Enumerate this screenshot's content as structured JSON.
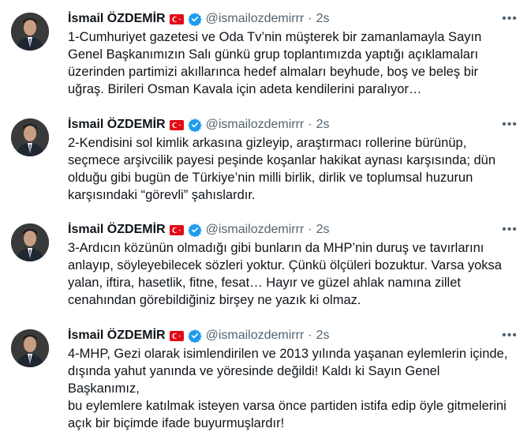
{
  "tweets": [
    {
      "author": {
        "name": "İsmail ÖZDEMİR",
        "handle": "@ismailozdemirrr",
        "verified": true
      },
      "separator": "·",
      "time": "2s",
      "more_icon": "more-horizontal-icon",
      "text": "1-Cumhuriyet gazetesi ve Oda Tv’nin müşterek bir zamanlamayla Sayın\nGenel Başkanımızın Salı günkü grup toplantımızda yaptığı açıklamaları\nüzerinden partimizi akıllarınca hedef almaları beyhude, boş ve beleş bir\nuğraş. Birileri Osman Kavala için adeta kendilerini paralıyor…"
    },
    {
      "author": {
        "name": "İsmail ÖZDEMİR",
        "handle": "@ismailozdemirrr",
        "verified": true
      },
      "separator": "·",
      "time": "2s",
      "more_icon": "more-horizontal-icon",
      "text": "2-Kendisini sol kimlik arkasına gizleyip, araştırmacı rollerine bürünüp,\nseçmece arşivcilik payesi peşinde koşanlar hakikat aynası karşısında; dün\nolduğu gibi bugün de Türkiye’nin milli birlik, dirlik ve toplumsal huzurun\nkarşısındaki “görevli” şahıslardır."
    },
    {
      "author": {
        "name": "İsmail ÖZDEMİR",
        "handle": "@ismailozdemirrr",
        "verified": true
      },
      "separator": "·",
      "time": "2s",
      "more_icon": "more-horizontal-icon",
      "text": "3-Ardıcın közünün olmadığı gibi bunların da MHP’nin duruş ve tavırlarını\nanlayıp, söyleyebilecek sözleri yoktur. Çünkü ölçüleri bozuktur. Varsa yoksa\nyalan, iftira, hasetlik, fitne, fesat… Hayır ve güzel ahlak namına zillet\ncenahından görebildiğiniz birşey ne yazık ki olmaz."
    },
    {
      "author": {
        "name": "İsmail ÖZDEMİR",
        "handle": "@ismailozdemirrr",
        "verified": true
      },
      "separator": "·",
      "time": "2s",
      "more_icon": "more-horizontal-icon",
      "text": "4-MHP, Gezi olarak isimlendirilen ve 2013 yılında yaşanan eylemlerin içinde,\ndışında yahut yanında ve yöresinde değildi! Kaldı ki Sayın Genel Başkanımız,\nbu eylemlere katılmak isteyen varsa önce partiden istifa edip öyle gitmelerini\naçık bir biçimde ifade buyurmuşlardır!"
    }
  ],
  "colors": {
    "text": "#0f1419",
    "secondary": "#536471",
    "verified": "#1d9bf0",
    "flag": "#e30a17"
  }
}
